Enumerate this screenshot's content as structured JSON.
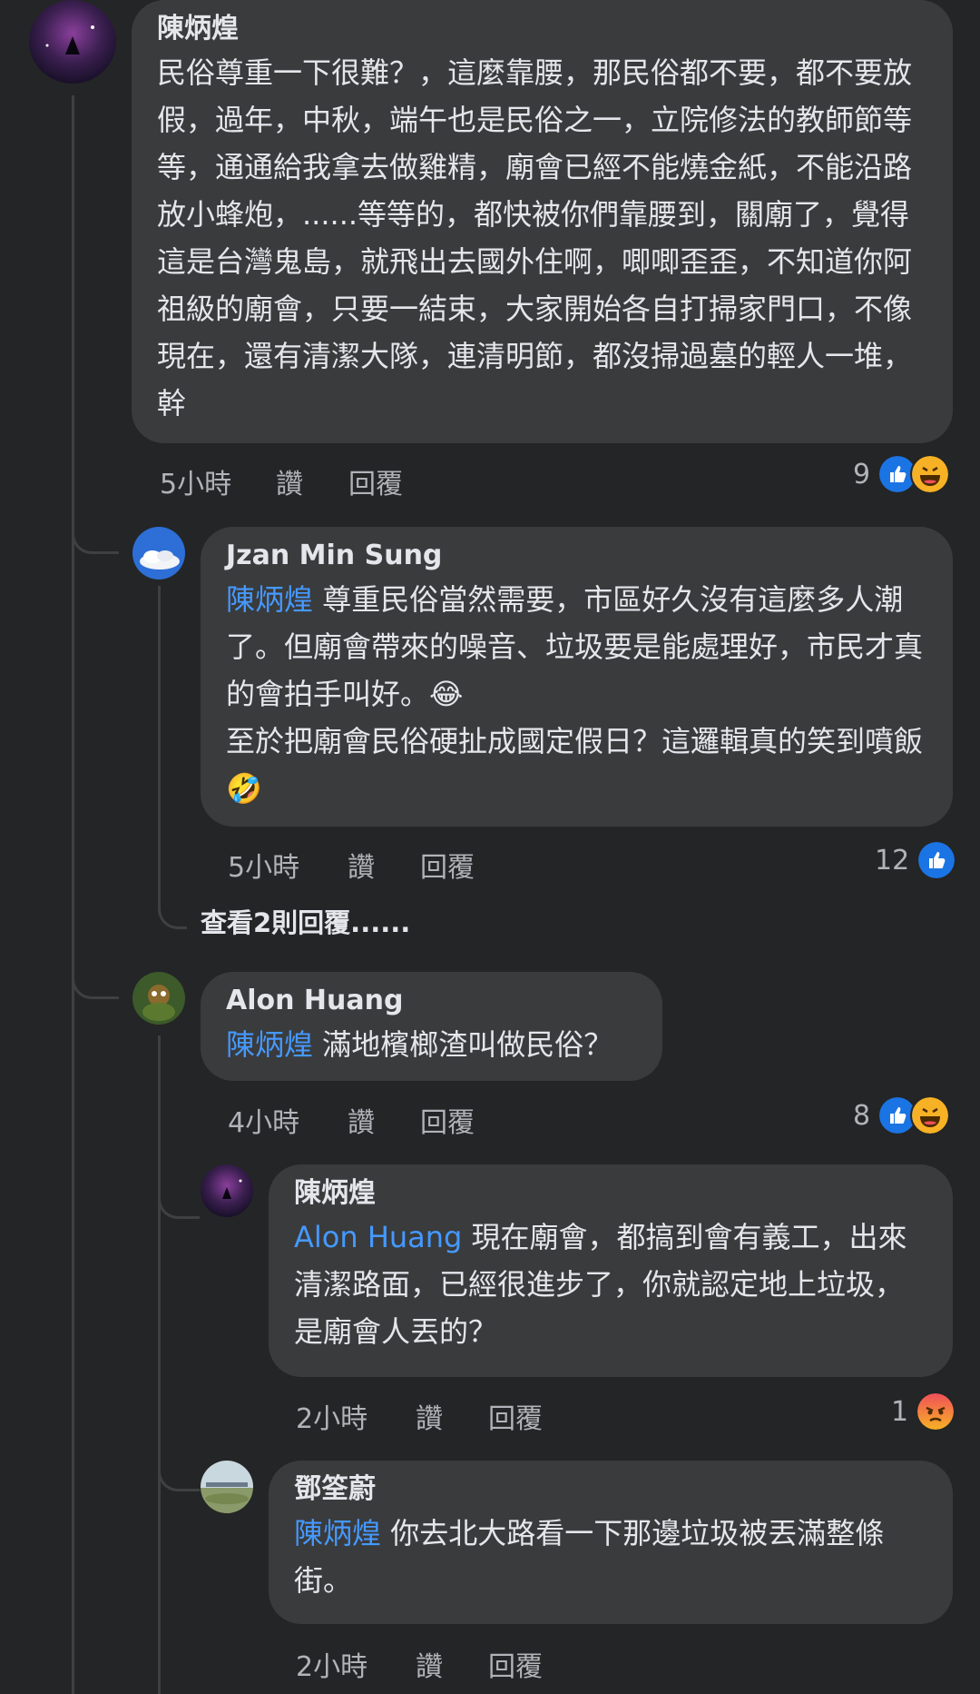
{
  "comments": [
    {
      "author": "陳炳煌",
      "body": "民俗尊重一下很難？，這麼靠腰，那民俗都不要，都不要放假，過年，中秋，端午也是民俗之一，立院修法的教師節等等，通通給我拿去做雞精，廟會已經不能燒金紙，不能沿路放小蜂炮，......等等的，都快被你們靠腰到，關廟了，覺得這是台灣鬼島，就飛出去國外住啊，唧唧歪歪，不知道你阿祖級的廟會，只要一結束，大家開始各自打掃家門口，不像現在，還有清潔大隊，連清明節，都沒掃過墓的輕人一堆，幹",
      "time": "5小時",
      "like": "讚",
      "reply": "回覆",
      "reaction_count": "9"
    },
    {
      "author": "Jzan Min Sung",
      "mention": "陳炳煌",
      "body": "尊重民俗當然需要，市區好久沒有這麼多人潮了。但廟會帶來的噪音、垃圾要是能處理好，市民才真的會拍手叫好。",
      "emoji1": "😂",
      "body2": "至於把廟會民俗硬扯成國定假日？這邏輯真的笑到噴飯",
      "emoji2": "🤣",
      "time": "5小時",
      "like": "讚",
      "reply": "回覆",
      "reaction_count": "12"
    },
    {
      "author": "Alon Huang",
      "mention": "陳炳煌",
      "body": "滿地檳榔渣叫做民俗？",
      "time": "4小時",
      "like": "讚",
      "reply": "回覆",
      "reaction_count": "8"
    },
    {
      "author": "陳炳煌",
      "mention": "Alon Huang",
      "body": "現在廟會，都搞到會有義工，出來清潔路面，已經很進步了，你就認定地上垃圾，是廟會人丟的？",
      "time": "2小時",
      "like": "讚",
      "reply": "回覆",
      "reaction_count": "1"
    },
    {
      "author": "鄧筌蔚",
      "mention": "陳炳煌",
      "body": "你去北大路看一下那邊垃圾被丟滿整條街。",
      "time": "2小時",
      "like": "讚",
      "reply": "回覆"
    }
  ],
  "view_more_replies": "查看2則回覆......",
  "colors": {
    "background": "#242526",
    "bubble": "#3a3b3c",
    "mention": "#4599ff",
    "meta": "#b0b3b8",
    "like_blue": "#1b74e4",
    "haha_yellow": "#f7b125",
    "angry_red": "#e9710f"
  },
  "icons": [
    "like-reaction-icon",
    "haha-reaction-icon",
    "angry-reaction-icon"
  ]
}
